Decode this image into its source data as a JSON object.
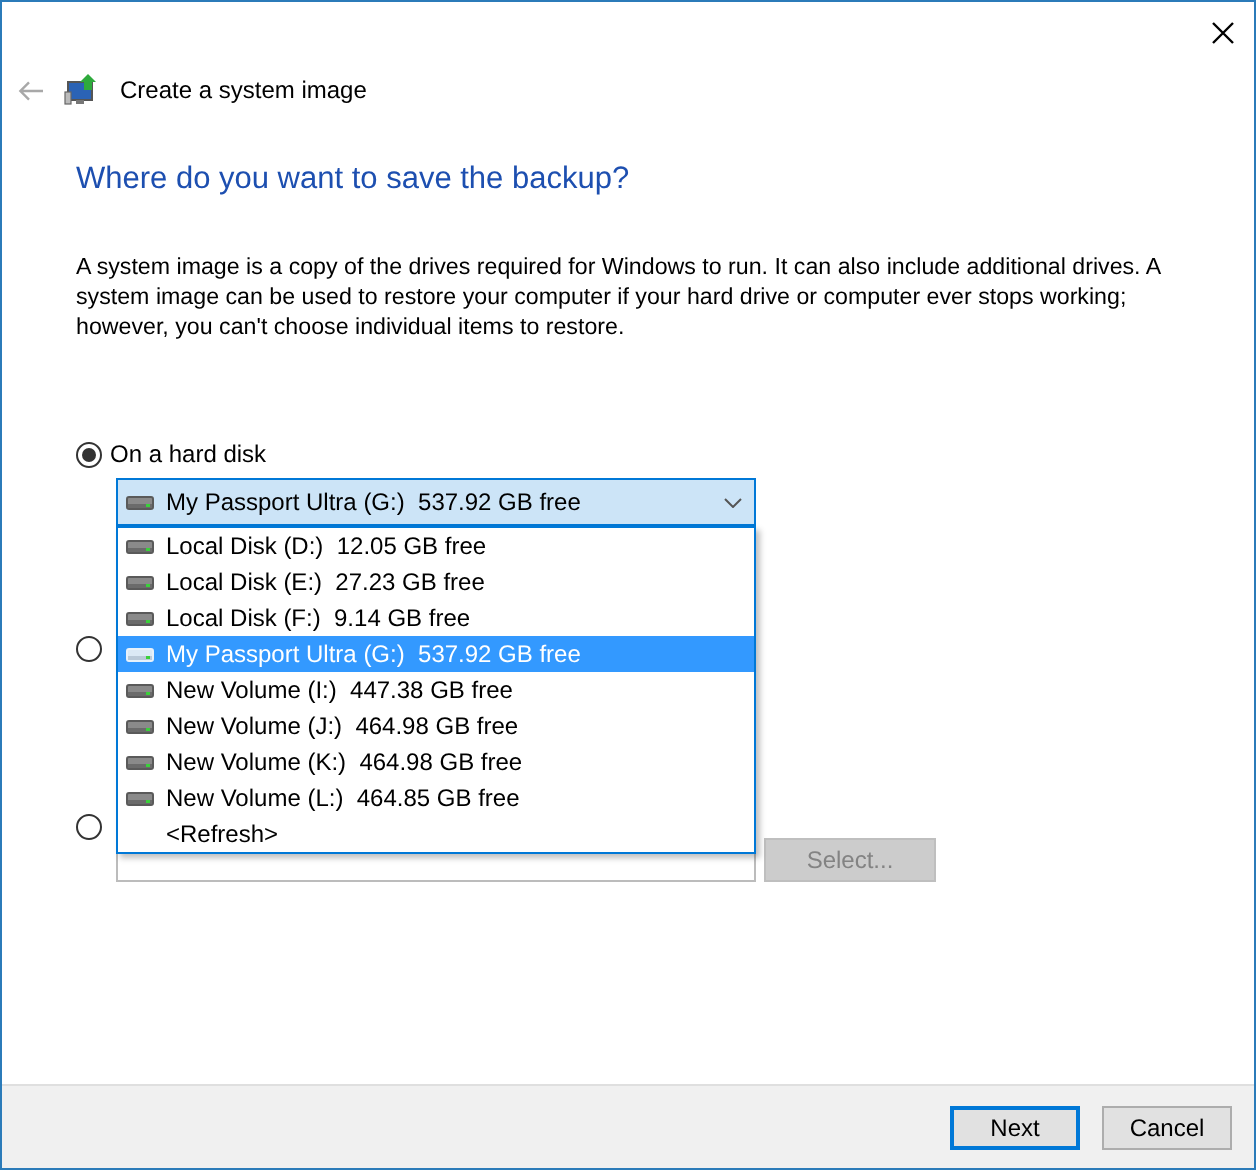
{
  "window": {
    "title": "Create a system image"
  },
  "heading": "Where do you want to save the backup?",
  "description": "A system image is a copy of the drives required for Windows to run. It can also include additional drives. A system image can be used to restore your computer if your hard drive or computer ever stops working; however, you can't choose individual items to restore.",
  "options": [
    {
      "label": "On a hard disk",
      "selected": true
    },
    {
      "selected": false
    },
    {
      "selected": false
    }
  ],
  "drive_combo": {
    "value": "My Passport Ultra (G:)  537.92 GB free",
    "expanded": true,
    "items": [
      {
        "kind": "drive",
        "label": "Local Disk (D:)  12.05 GB free",
        "selected": false
      },
      {
        "kind": "drive",
        "label": "Local Disk (E:)  27.23 GB free",
        "selected": false
      },
      {
        "kind": "drive",
        "label": "Local Disk (F:)  9.14 GB free",
        "selected": false
      },
      {
        "kind": "drive",
        "label": "My Passport Ultra (G:)  537.92 GB free",
        "selected": true
      },
      {
        "kind": "drive",
        "label": "New Volume (I:)  447.38 GB free",
        "selected": false
      },
      {
        "kind": "drive",
        "label": "New Volume (J:)  464.98 GB free",
        "selected": false
      },
      {
        "kind": "drive",
        "label": "New Volume (K:)  464.98 GB free",
        "selected": false
      },
      {
        "kind": "drive",
        "label": "New Volume (L:)  464.85 GB free",
        "selected": false
      },
      {
        "kind": "command",
        "label": "<Refresh>",
        "selected": false
      }
    ]
  },
  "select_button": {
    "label": "Select...",
    "disabled": true
  },
  "buttons": [
    {
      "label": "Next",
      "default": true
    },
    {
      "label": "Cancel",
      "default": false
    }
  ]
}
